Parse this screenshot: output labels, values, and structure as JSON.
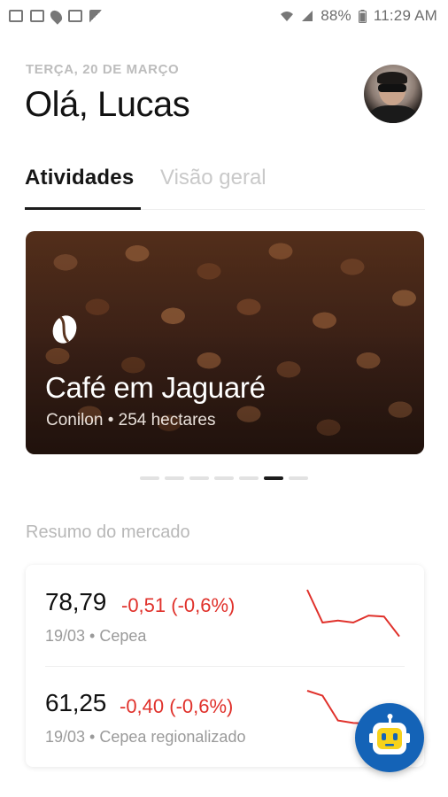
{
  "status_bar": {
    "battery": "88%",
    "time": "11:29 AM",
    "icons": [
      "image-icon",
      "mail-icon",
      "location-icon",
      "sim-icon",
      "flag-icon",
      "wifi-icon",
      "signal-icon",
      "battery-icon"
    ]
  },
  "header": {
    "date": "TERÇA, 20 DE MARÇO",
    "greeting": "Olá, Lucas",
    "avatar": "user-avatar"
  },
  "tabs": [
    {
      "label": "Atividades",
      "active": true
    },
    {
      "label": "Visão geral",
      "active": false
    }
  ],
  "activity_card": {
    "icon": "coffee-bean-icon",
    "title": "Café em Jaguaré",
    "subtitle": "Conilon • 254 hectares"
  },
  "pager": {
    "count": 7,
    "active_index": 5
  },
  "market": {
    "section_title": "Resumo do mercado",
    "items": [
      {
        "price": "78,79",
        "change": "-0,51 (-0,6%)",
        "meta": "19/03 • Cepea",
        "trend": [
          100,
          34,
          38,
          34,
          48,
          46,
          6
        ]
      },
      {
        "price": "61,25",
        "change": "-0,40 (-0,6%)",
        "meta": "19/03 • Cepea regionalizado",
        "trend": [
          100,
          90,
          40,
          35,
          34,
          34,
          30
        ]
      }
    ]
  },
  "colors": {
    "negative": "#e0312b",
    "fab": "#1463b7",
    "accent_text": "#1c1c1c"
  },
  "fab": {
    "icon": "assistant-robot-icon"
  }
}
